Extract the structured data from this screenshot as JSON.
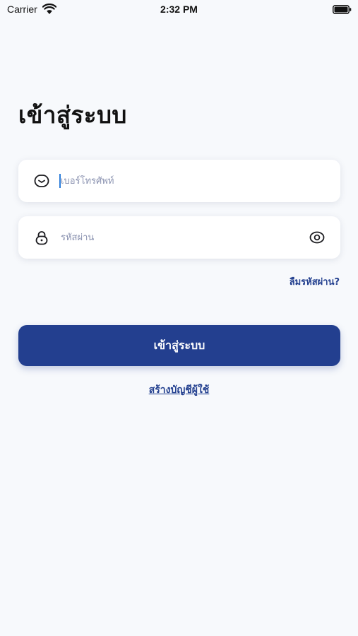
{
  "status_bar": {
    "carrier": "Carrier",
    "time": "2:32 PM",
    "wifi_icon": "wifi-icon",
    "battery_icon": "battery-icon"
  },
  "login": {
    "title": "เข้าสู่ระบบ",
    "phone": {
      "placeholder": "เบอร์โทรศัพท์",
      "value": "",
      "icon": "phone-icon"
    },
    "password": {
      "placeholder": "รหัสผ่าน",
      "value": "",
      "icon": "lock-icon",
      "toggle_icon": "eye-icon"
    },
    "forgot_password": "ลืมรหัสผ่าน?",
    "submit_label": "เข้าสู่ระบบ",
    "register_label": "สร้างบัญชีผู้ใช้"
  },
  "colors": {
    "background": "#f7f9fc",
    "primary": "#233f8f",
    "placeholder": "#8a92b0",
    "caret": "#2b7cd9"
  }
}
